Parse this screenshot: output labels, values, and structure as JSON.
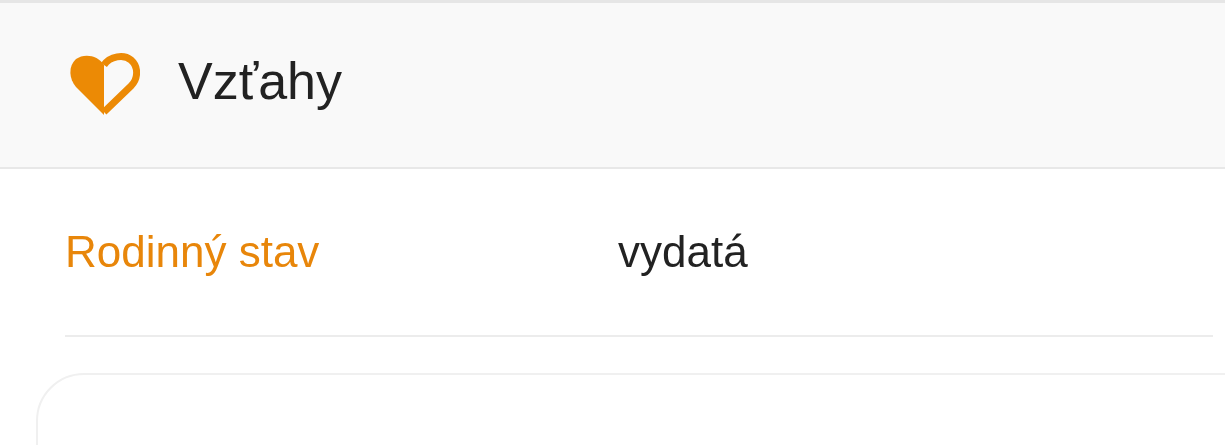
{
  "section": {
    "title": "Vzťahy"
  },
  "fields": [
    {
      "label": "Rodinný stav",
      "value": "vydatá"
    }
  ]
}
